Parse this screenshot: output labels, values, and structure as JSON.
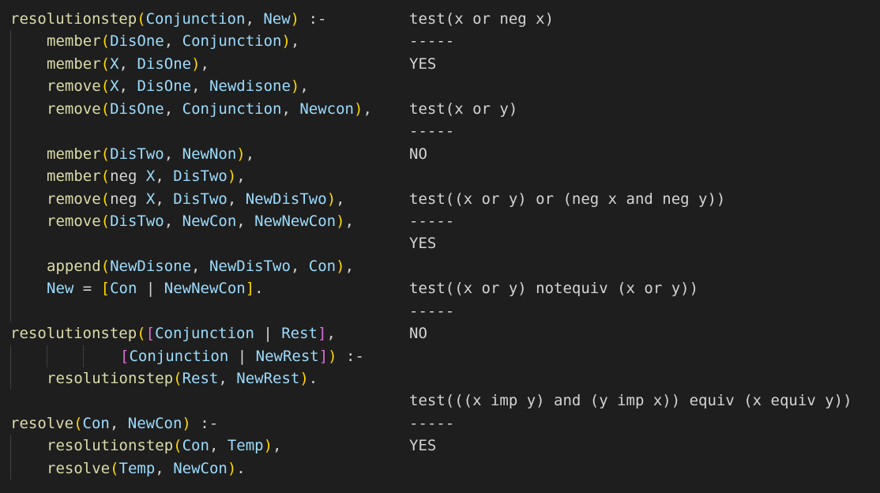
{
  "left_code": {
    "l1": {
      "fn": "resolutionstep",
      "o": "(",
      "a1": "Conjunction",
      "s1": ", ",
      "a2": "New",
      "c": ")",
      "t": " :-"
    },
    "l2": {
      "fn": "member",
      "o": "(",
      "a1": "DisOne",
      "s1": ", ",
      "a2": "Conjunction",
      "c": ")",
      "t": ","
    },
    "l3": {
      "fn": "member",
      "o": "(",
      "a1": "X",
      "s1": ", ",
      "a2": "DisOne",
      "c": ")",
      "t": ","
    },
    "l4": {
      "fn": "remove",
      "o": "(",
      "a1": "X",
      "s1": ", ",
      "a2": "DisOne",
      "s2": ", ",
      "a3": "Newdisone",
      "c": ")",
      "t": ","
    },
    "l5": {
      "fn": "remove",
      "o": "(",
      "a1": "DisOne",
      "s1": ", ",
      "a2": "Conjunction",
      "s2": ", ",
      "a3": "Newcon",
      "c": ")",
      "t": ","
    },
    "l7": {
      "fn": "member",
      "o": "(",
      "a1": "DisTwo",
      "s1": ", ",
      "a2": "NewNon",
      "c": ")",
      "t": ","
    },
    "l8": {
      "fn": "member",
      "o": "(",
      "p1": "neg ",
      "a1": "X",
      "s1": ", ",
      "a2": "DisTwo",
      "c": ")",
      "t": ","
    },
    "l9": {
      "fn": "remove",
      "o": "(",
      "p1": "neg ",
      "a1": "X",
      "s1": ", ",
      "a2": "DisTwo",
      "s2": ", ",
      "a3": "NewDisTwo",
      "c": ")",
      "t": ","
    },
    "l10": {
      "fn": "remove",
      "o": "(",
      "a1": "DisTwo",
      "s1": ", ",
      "a2": "NewCon",
      "s2": ", ",
      "a3": "NewNewCon",
      "c": ")",
      "t": ","
    },
    "l12": {
      "fn": "append",
      "o": "(",
      "a1": "NewDisone",
      "s1": ", ",
      "a2": "NewDisTwo",
      "s2": ", ",
      "a3": "Con",
      "c": ")",
      "t": ","
    },
    "l13": {
      "a0": "New",
      "eq": " = ",
      "o": "[",
      "a1": "Con",
      "bar": " | ",
      "a2": "NewNewCon",
      "c": "]",
      "t": "."
    },
    "l15": {
      "fn": "resolutionstep",
      "o": "(",
      "ob": "[",
      "a1": "Conjunction",
      "bar": " | ",
      "a2": "Rest",
      "cb": "]",
      "t": ","
    },
    "l16": {
      "ob": "[",
      "a1": "Conjunction",
      "bar": " | ",
      "a2": "NewRest",
      "cb": "]",
      "c": ")",
      "t": " :-"
    },
    "l17": {
      "fn": "resolutionstep",
      "o": "(",
      "a1": "Rest",
      "s1": ", ",
      "a2": "NewRest",
      "c": ")",
      "t": "."
    },
    "l19": {
      "fn": "resolve",
      "o": "(",
      "a1": "Con",
      "s1": ", ",
      "a2": "NewCon",
      "c": ")",
      "t": " :-"
    },
    "l20": {
      "fn": "resolutionstep",
      "o": "(",
      "a1": "Con",
      "s1": ", ",
      "a2": "Temp",
      "c": ")",
      "t": ","
    },
    "l21": {
      "fn": "resolve",
      "o": "(",
      "a1": "Temp",
      "s1": ", ",
      "a2": "NewCon",
      "c": ")",
      "t": "."
    }
  },
  "right_output": [
    {
      "query": "test(x or neg x)",
      "sep": "-----",
      "result": "YES"
    },
    {
      "query": "test(x or y)",
      "sep": "-----",
      "result": "NO"
    },
    {
      "query": "test((x or y) or (neg x and neg y))",
      "sep": "-----",
      "result": "YES"
    },
    {
      "query": "test((x or y) notequiv (x or y))",
      "sep": "-----",
      "result": "NO"
    },
    {
      "query": "test(((x imp y) and (y imp x)) equiv (x equiv y))",
      "sep": "-----",
      "result": "YES"
    }
  ]
}
